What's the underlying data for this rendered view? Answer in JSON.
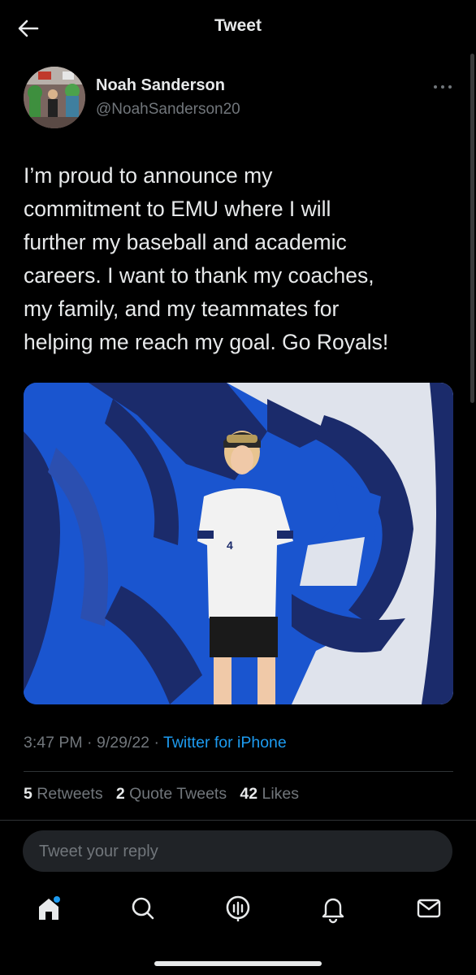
{
  "header": {
    "title": "Tweet",
    "back_icon": "arrow-left-icon"
  },
  "author": {
    "display_name": "Noah Sanderson",
    "handle": "@NoahSanderson20"
  },
  "tweet": {
    "text": "I’m proud to announce my\ncommitment to EMU where I will\nfurther my baseball and academic\ncareers. I want to thank my coaches,\nmy family, and my teammates for\nhelping me reach my goal. Go Royals!",
    "jersey_number": "4",
    "time": "3:47 PM",
    "date": "9/29/22",
    "source": "Twitter for iPhone"
  },
  "stats": {
    "retweets_count": "5",
    "retweets_label": "Retweets",
    "quotes_count": "2",
    "quotes_label": "Quote Tweets",
    "likes_count": "42",
    "likes_label": "Likes"
  },
  "reply": {
    "placeholder": "Tweet your reply"
  },
  "tabbar": [
    "home-icon",
    "search-icon",
    "spaces-icon",
    "bell-icon",
    "mail-icon"
  ],
  "colors": {
    "link": "#1d9bf0",
    "secondary_text": "#71767b",
    "background": "#000000"
  }
}
